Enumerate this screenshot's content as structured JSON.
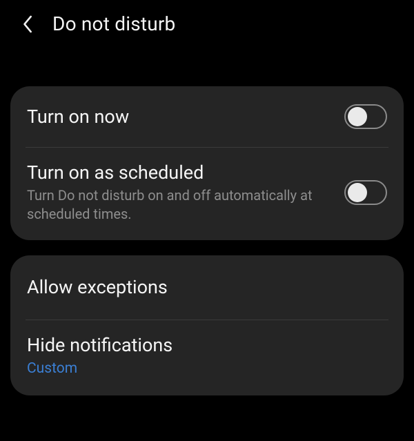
{
  "header": {
    "title": "Do not disturb"
  },
  "card1": {
    "row1": {
      "title": "Turn on now"
    },
    "row2": {
      "title": "Turn on as scheduled",
      "sub": "Turn Do not disturb on and off automatically at scheduled times."
    }
  },
  "card2": {
    "row1": {
      "title": "Allow exceptions"
    },
    "row2": {
      "title": "Hide notifications",
      "sub": "Custom"
    }
  }
}
